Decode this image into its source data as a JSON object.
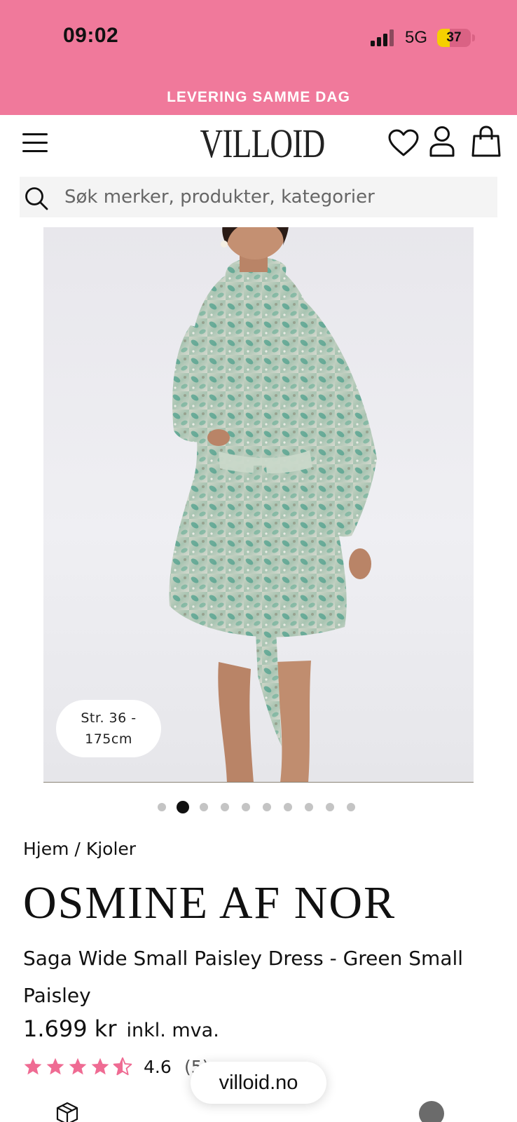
{
  "status_bar": {
    "time": "09:02",
    "network": "5G",
    "battery": "37",
    "battery_level": 0.37,
    "background_color": "#f0799b"
  },
  "promo_banner": {
    "text": "LEVERING SAMME DAG",
    "color": "#f0799b"
  },
  "header": {
    "logo": "VILLOID",
    "icons": [
      "menu-icon",
      "heart-icon",
      "user-icon",
      "shopping-bag-icon"
    ]
  },
  "search": {
    "placeholder": "Søk merker, produkter, kategorier",
    "icon": "search-icon"
  },
  "gallery": {
    "size_badge": "Str. 36 - 175cm",
    "slide_count": 10,
    "active_slide": 2
  },
  "product": {
    "breadcrumb": {
      "home": "Hjem",
      "separator": " / ",
      "category": "Kjoler"
    },
    "brand": "OSMINE AF NOR",
    "title": "Saga Wide Small Paisley Dress - Green Small Paisley",
    "price": "1.699 kr",
    "price_note": "inkl. mva.",
    "rating": {
      "stars": 4.6,
      "value": "4.6",
      "count": "(5)",
      "star_color": "#ef6b93"
    }
  },
  "browser": {
    "url": "villoid.no"
  },
  "bottom_icons": [
    "box-icon",
    "chat-icon"
  ]
}
